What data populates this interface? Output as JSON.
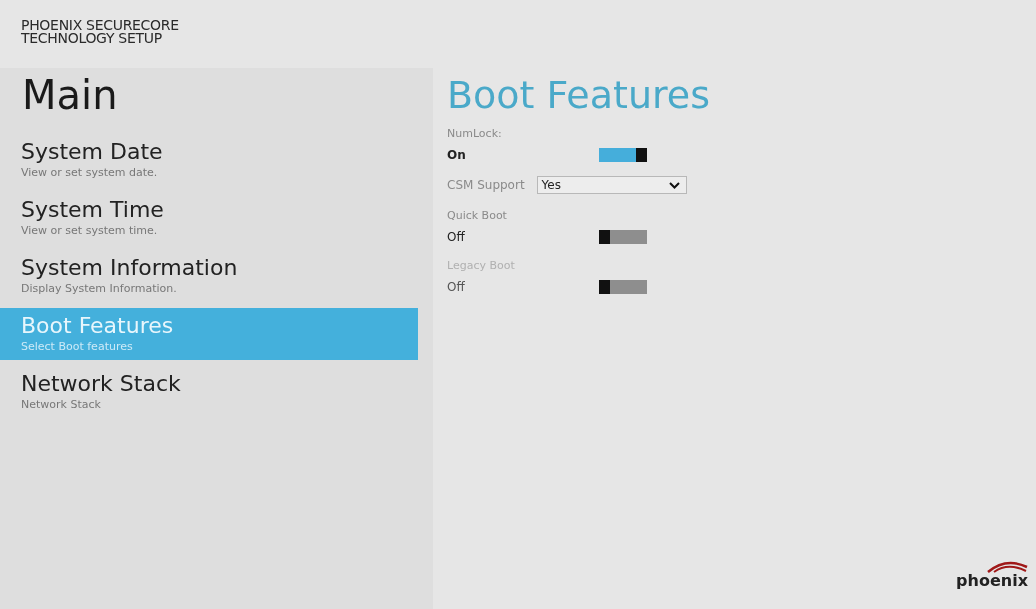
{
  "header": {
    "title_lines": [
      "PHOENIX SECURECORE",
      "TECHNOLOGY SETUP"
    ]
  },
  "menu": {
    "title": "Main",
    "items": [
      {
        "label": "System Date",
        "description": "View or set system date.",
        "selected": false
      },
      {
        "label": "System Time",
        "description": "View or set system time.",
        "selected": false
      },
      {
        "label": "System Information",
        "description": "Display System Information.",
        "selected": false
      },
      {
        "label": "Boot Features",
        "description": "Select Boot features",
        "selected": true
      },
      {
        "label": "Network Stack",
        "description": "Network Stack",
        "selected": false
      }
    ]
  },
  "panel": {
    "title": "Boot Features",
    "settings": [
      {
        "kind": "toggle",
        "label": "NumLock:",
        "value": "On",
        "on": true,
        "disabled": false
      },
      {
        "kind": "select",
        "label": "CSM Support",
        "value": "Yes",
        "disabled": false
      },
      {
        "kind": "toggle",
        "label": "Quick Boot",
        "value": "Off",
        "on": false,
        "disabled": false
      },
      {
        "kind": "toggle",
        "label": "Legacy Boot",
        "value": "Off",
        "on": false,
        "disabled": true
      }
    ]
  },
  "logo": {
    "text": "phoenix"
  }
}
